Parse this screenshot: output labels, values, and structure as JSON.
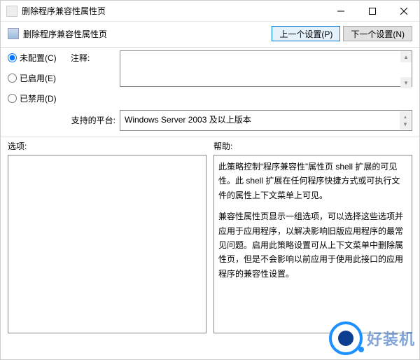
{
  "window": {
    "title": "删除程序兼容性属性页"
  },
  "header": {
    "title": "删除程序兼容性属性页",
    "prev_btn": "上一个设置(P)",
    "next_btn": "下一个设置(N)"
  },
  "radios": {
    "not_configured": "未配置(C)",
    "enabled": "已启用(E)",
    "disabled": "已禁用(D)",
    "selected": "not_configured"
  },
  "comment": {
    "label": "注释:",
    "value": ""
  },
  "platform": {
    "label": "支持的平台:",
    "value": "Windows Server 2003 及以上版本"
  },
  "options": {
    "label": "选项:",
    "value": ""
  },
  "help": {
    "label": "帮助:",
    "p1": "此策略控制“程序兼容性”属性页 shell 扩展的可见性。此 shell 扩展在任何程序快捷方式或可执行文件的属性上下文菜单上可见。",
    "p2": "兼容性属性页显示一组选项，可以选择这些选项并应用于应用程序，以解决影响旧版应用程序的最常见问题。启用此策略设置可从上下文菜单中删除属性页，但是不会影响以前应用于使用此接口的应用程序的兼容性设置。"
  },
  "watermark": {
    "text": "好装机"
  }
}
